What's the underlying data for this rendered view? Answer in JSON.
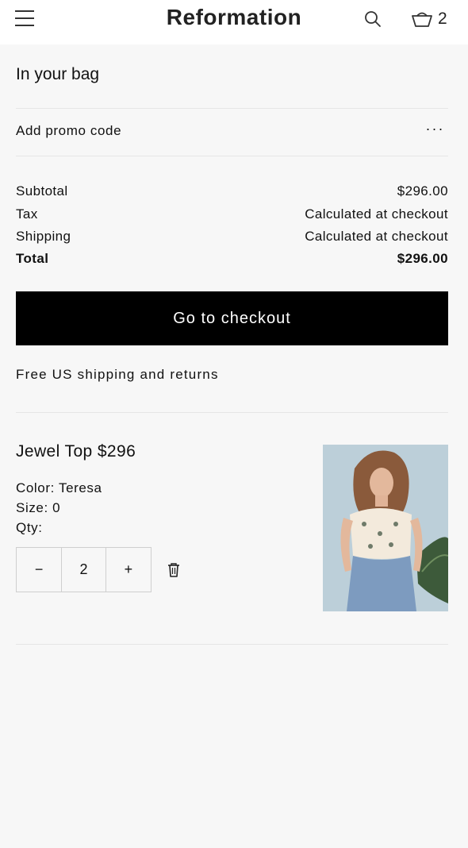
{
  "header": {
    "logo": "Reformation",
    "bag_count": "2"
  },
  "bag": {
    "title": "In your bag",
    "promo_label": "Add promo code",
    "promo_more": "...",
    "summary": {
      "subtotal_label": "Subtotal",
      "subtotal_value": "$296.00",
      "tax_label": "Tax",
      "tax_value": "Calculated at checkout",
      "shipping_label": "Shipping",
      "shipping_value": "Calculated at checkout",
      "total_label": "Total",
      "total_value": "$296.00"
    },
    "checkout_label": "Go to checkout",
    "free_shipping": "Free US shipping and returns"
  },
  "item": {
    "name_price": "Jewel Top $296",
    "color": "Color: Teresa",
    "size": "Size: 0",
    "qty_label": "Qty:",
    "qty_value": "2",
    "decrement": "−",
    "increment": "+"
  },
  "colors": {
    "button_bg": "#000000",
    "page_bg": "#f7f7f7"
  }
}
